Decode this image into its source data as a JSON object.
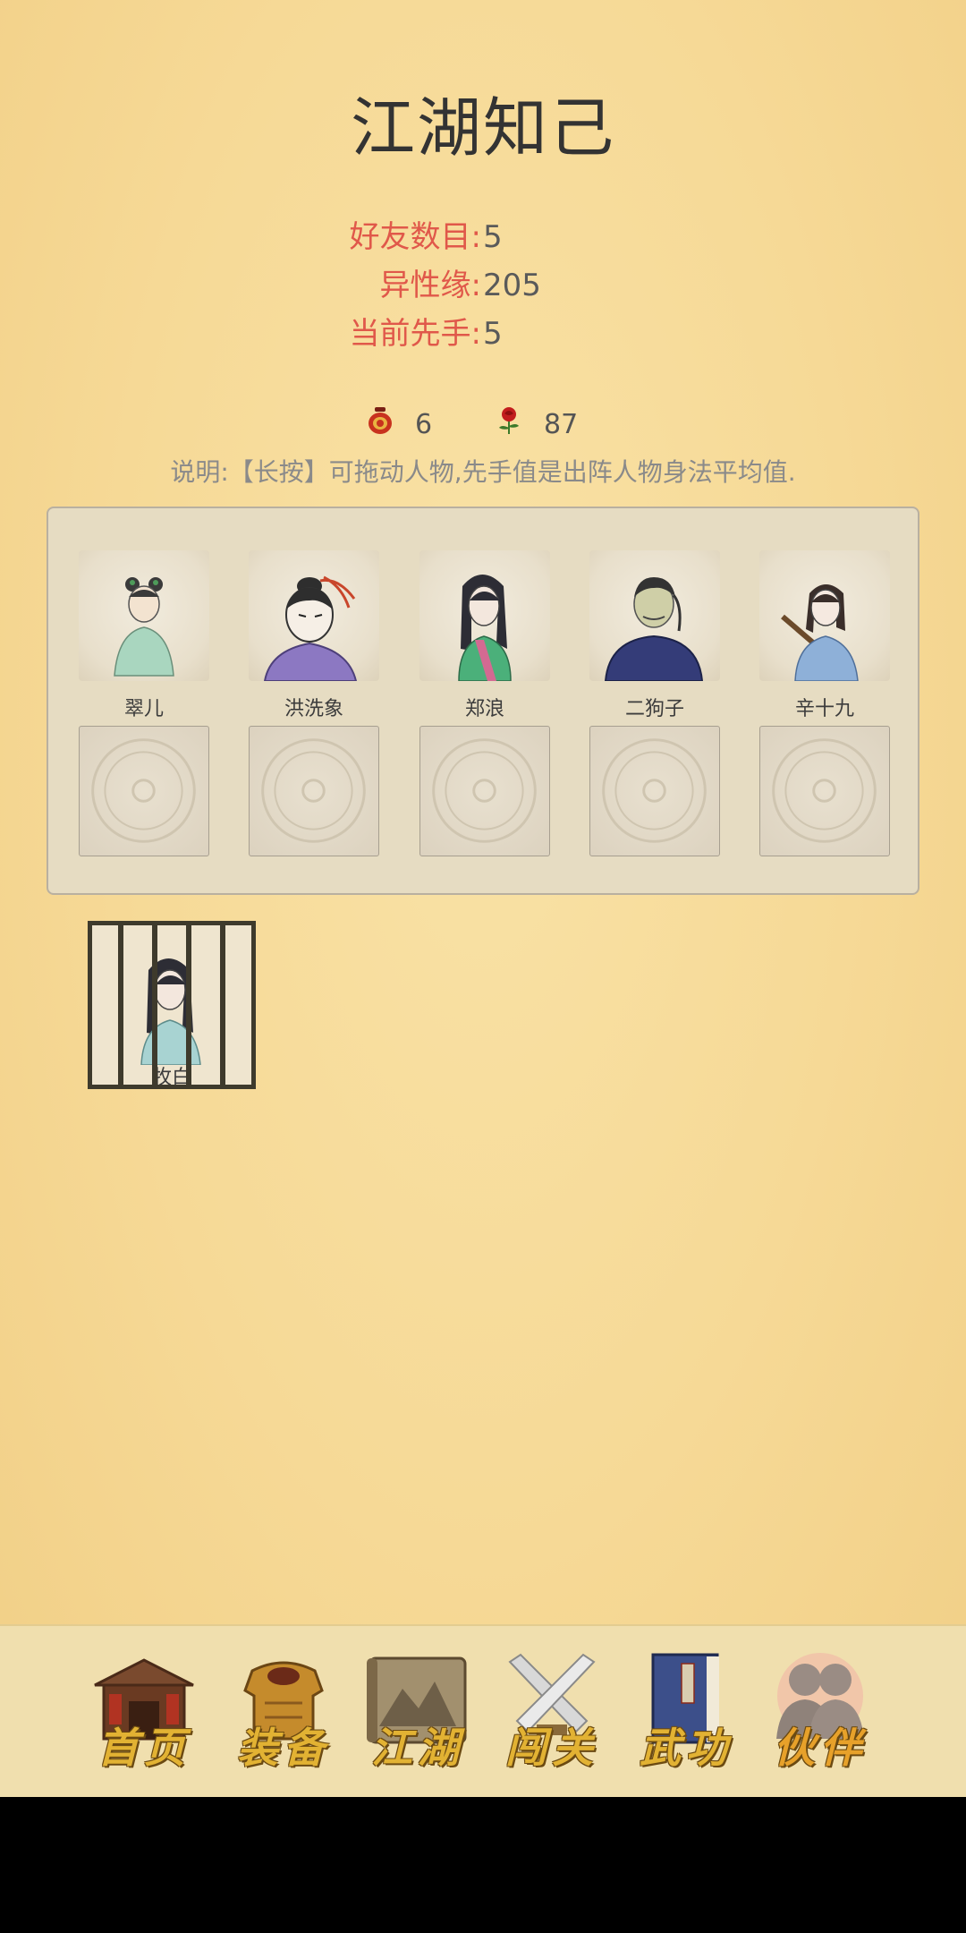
{
  "page_title": "江湖知己",
  "stats": [
    {
      "label": "好友数目:",
      "value": "5"
    },
    {
      "label": "异性缘:",
      "value": "205"
    },
    {
      "label": "当前先手:",
      "value": "5"
    }
  ],
  "resources": [
    {
      "icon": "wine-jar-icon",
      "value": "6"
    },
    {
      "icon": "rose-icon",
      "value": "87"
    }
  ],
  "note": "说明:【长按】可拖动人物,先手值是出阵人物身法平均值.",
  "companions": [
    {
      "name": "翠儿"
    },
    {
      "name": "洪洗象"
    },
    {
      "name": "郑浪"
    },
    {
      "name": "二狗子"
    },
    {
      "name": "辛十九"
    }
  ],
  "empty_slots": 5,
  "jailed": {
    "name": "牧白"
  },
  "nav": [
    {
      "label": "首页",
      "icon": "house-icon"
    },
    {
      "label": "装备",
      "icon": "armor-icon"
    },
    {
      "label": "江湖",
      "icon": "scroll-map-icon"
    },
    {
      "label": "闯关",
      "icon": "crossed-swords-icon"
    },
    {
      "label": "武功",
      "icon": "book-icon"
    },
    {
      "label": "伙伴",
      "icon": "partners-icon",
      "active": true
    }
  ]
}
